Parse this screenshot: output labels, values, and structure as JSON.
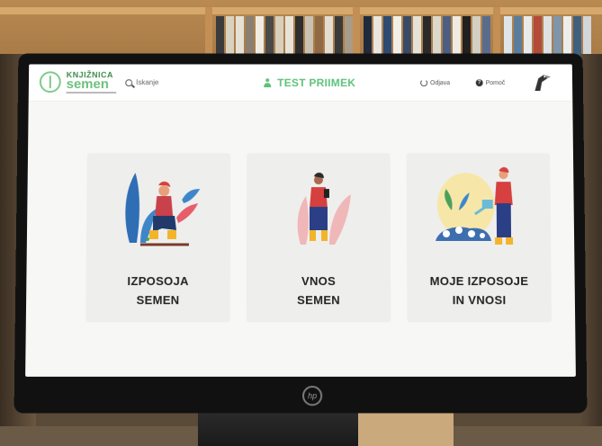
{
  "header": {
    "logo": {
      "top": "KNJIŽNICA",
      "main": "semen"
    },
    "search": {
      "label": "Iskanje",
      "icon": "search-icon"
    },
    "user": {
      "name": "TEST PRIIMEK",
      "icon": "user-icon"
    },
    "logout": {
      "label": "Odjava",
      "icon": "power-icon"
    },
    "help": {
      "label": "Pomoč",
      "icon": "help-icon"
    }
  },
  "cards": [
    {
      "line1": "IZPOSOJA",
      "line2": "SEMEN"
    },
    {
      "line1": "VNOS",
      "line2": "SEMEN"
    },
    {
      "line1": "MOJE IZPOSOJE",
      "line2": "IN VNOSI"
    }
  ],
  "colors": {
    "accent": "#5cc27a",
    "brand": "#6cc07c",
    "card_bg": "#eeeeed",
    "screen_bg": "#f7f7f6"
  }
}
